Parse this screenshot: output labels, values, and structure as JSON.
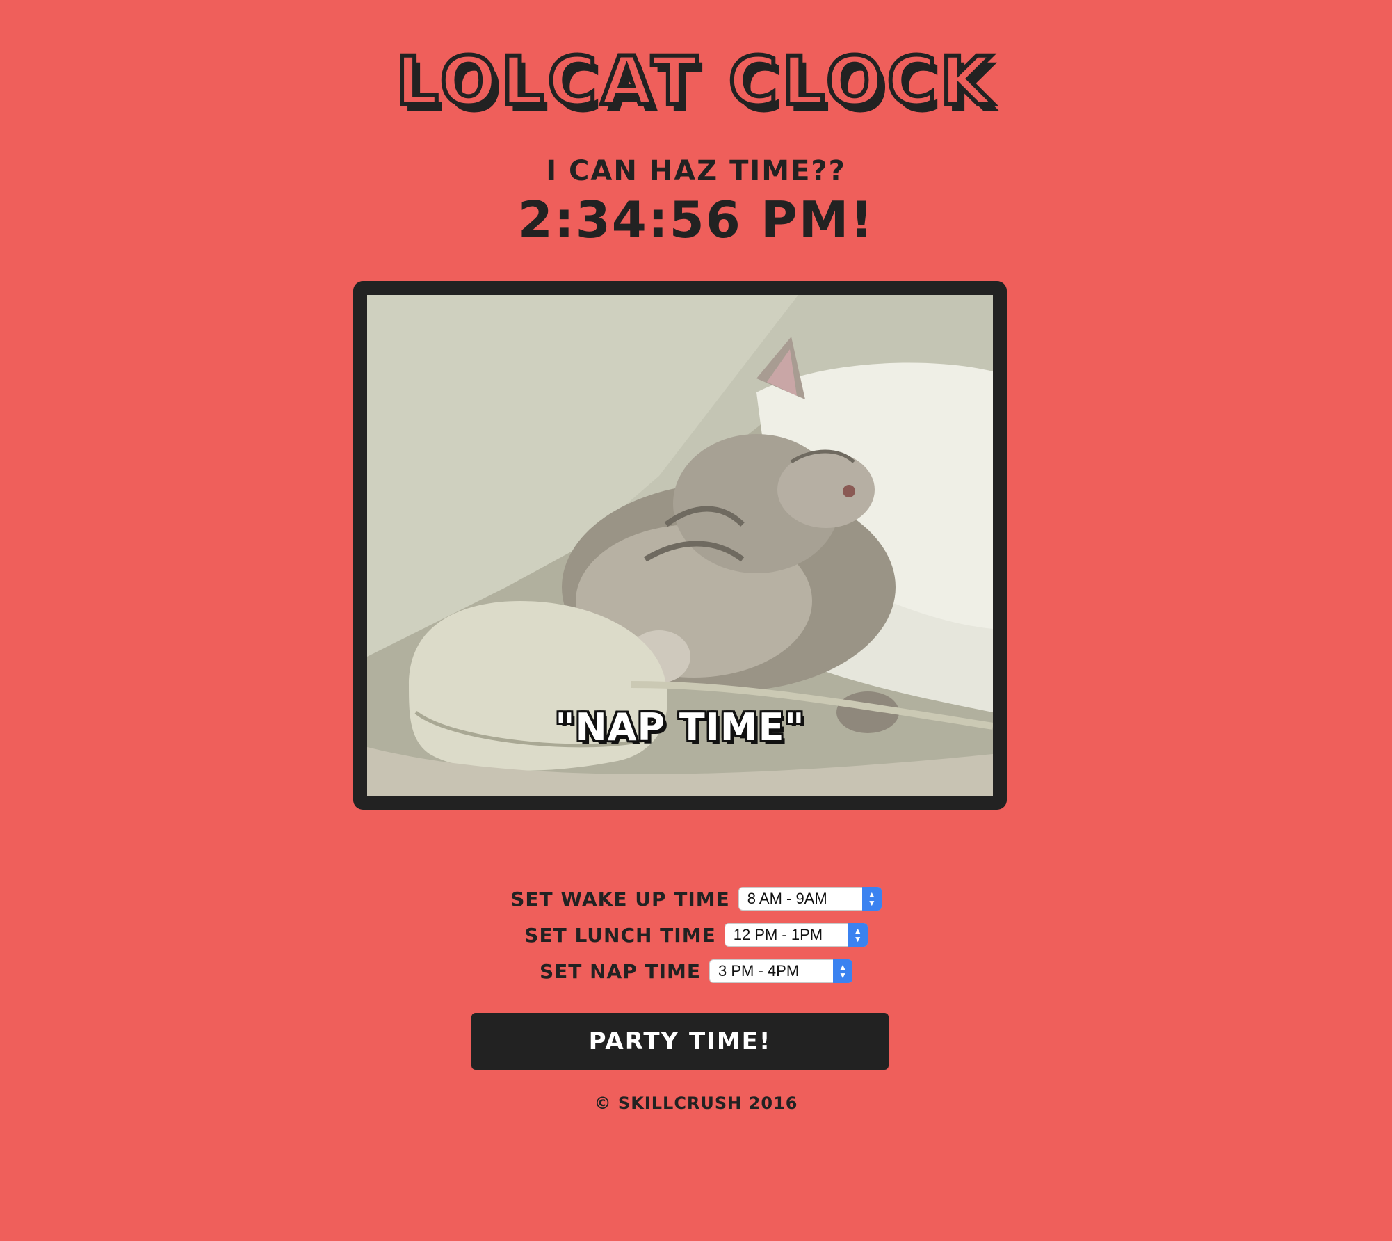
{
  "header": {
    "title": "LOLCAT CLOCK",
    "subtitle": "I CAN HAZ TIME??",
    "time": "2:34:56 PM!"
  },
  "image": {
    "caption": "\"NAP TIME\"",
    "subject": "sleeping-kitten-with-computer-mouse"
  },
  "controls": {
    "wake_up": {
      "label": "SET WAKE UP TIME",
      "value": "8 AM - 9AM"
    },
    "lunch": {
      "label": "SET LUNCH TIME",
      "value": "12 PM - 1PM"
    },
    "nap": {
      "label": "SET NAP TIME",
      "value": "3 PM - 4PM"
    }
  },
  "party_button": {
    "label": "PARTY TIME!"
  },
  "footer": {
    "text": "© SKILLCRUSH 2016"
  },
  "colors": {
    "background": "#ef5f5b",
    "dark": "#222222",
    "select_arrow": "#3b82f0"
  }
}
